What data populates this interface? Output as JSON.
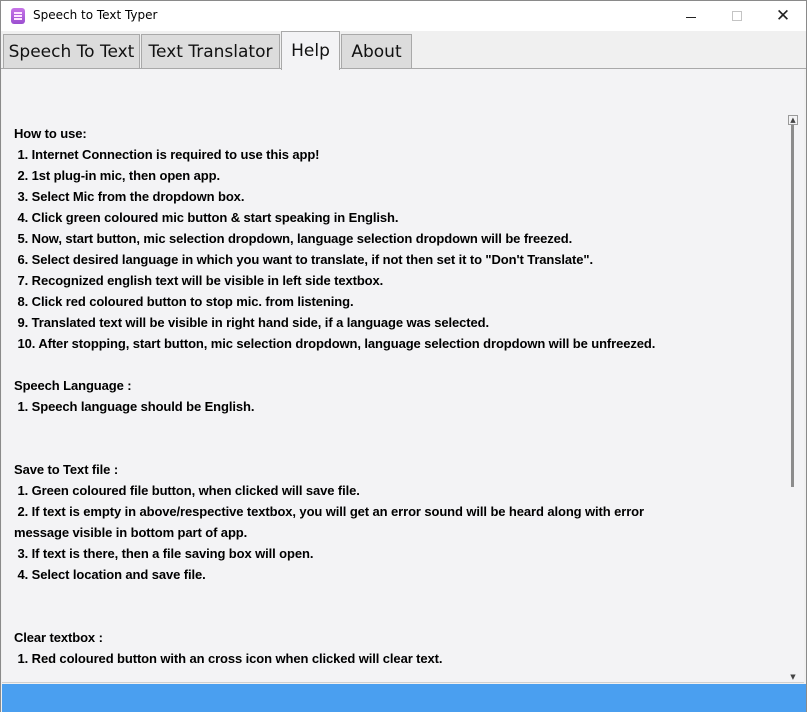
{
  "window": {
    "title": "Speech to Text Typer",
    "minimize_label": "",
    "maximize_label": "",
    "close_label": "✕"
  },
  "tabs": [
    {
      "label": "Speech To Text",
      "active": false
    },
    {
      "label": "Text Translator",
      "active": false
    },
    {
      "label": "Help",
      "active": true
    },
    {
      "label": "About",
      "active": false
    }
  ],
  "help": {
    "lines": [
      "How to use:",
      " 1. Internet Connection is required to use this app!",
      " 2. 1st plug-in mic, then open app.",
      " 3. Select Mic from the dropdown box.",
      " 4. Click green coloured mic button & start speaking in English.",
      " 5. Now, start button, mic selection dropdown, language selection dropdown will be freezed.",
      " 6. Select desired language in which you want to translate, if not then set it to \"Don't Translate\".",
      " 7. Recognized english text will be visible in left side textbox.",
      " 8. Click red coloured button to stop mic. from listening.",
      " 9. Translated text will be visible in right hand side, if a language was selected.",
      " 10. After stopping, start button, mic selection dropdown, language selection dropdown will be unfreezed.",
      "",
      "Speech Language :",
      " 1. Speech language should be English.",
      "",
      "",
      "Save to Text file :",
      " 1. Green coloured file button, when clicked will save file.",
      " 2. If text is empty in above/respective textbox, you will get an error sound will be heard along with error",
      "message visible in bottom part of app.",
      " 3. If text is there, then a file saving box will open.",
      " 4. Select location and save file.",
      "",
      "",
      "Clear textbox :",
      " 1. Red coloured button with an cross icon when clicked will clear text."
    ]
  },
  "colors": {
    "status_bar": "#4a9ff0",
    "panel_bg": "#f3f3f5",
    "tab_bg": "#dcdcdc"
  }
}
